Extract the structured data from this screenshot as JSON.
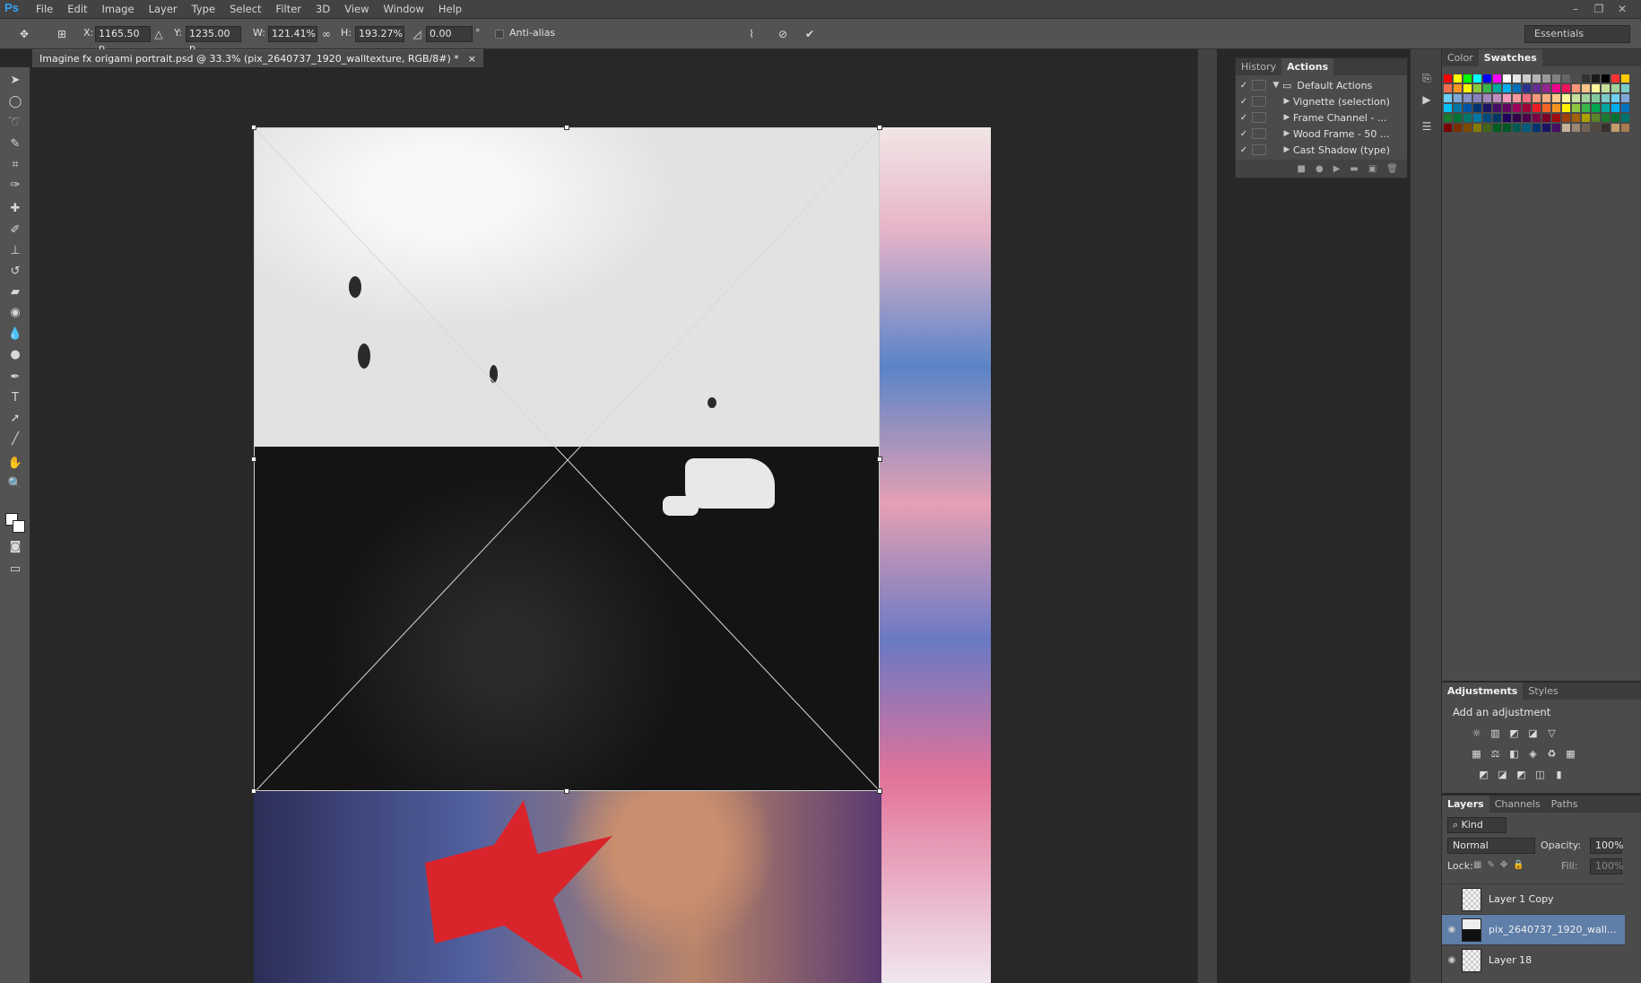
{
  "app": {
    "logo": "Ps"
  },
  "menu": [
    "File",
    "Edit",
    "Image",
    "Layer",
    "Type",
    "Select",
    "Filter",
    "3D",
    "View",
    "Window",
    "Help"
  ],
  "window_controls": [
    "–",
    "❐",
    "✕"
  ],
  "options": {
    "x_label": "X:",
    "x_value": "1165.50 p",
    "y_label": "Y:",
    "y_value": "1235.00 p",
    "w_label": "W:",
    "w_value": "121.41%",
    "h_label": "H:",
    "h_value": "193.27%",
    "angle_value": "0.00",
    "degree": "°",
    "antialias_label": "Anti-alias",
    "workspace": "Essentials"
  },
  "document": {
    "tab_title": "Imagine fx origami portrait.psd @ 33.3% (pix_2640737_1920_walltexture, RGB/8#) *",
    "close": "×"
  },
  "actions_panel": {
    "tabs": [
      "History",
      "Actions"
    ],
    "items": [
      {
        "label": "Default Actions",
        "check": "✓"
      },
      {
        "label": "Vignette (selection)",
        "check": "✓"
      },
      {
        "label": "Frame Channel - ...",
        "check": "✓"
      },
      {
        "label": "Wood Frame - 50 ...",
        "check": "✓"
      },
      {
        "label": "Cast Shadow (type)",
        "check": "✓"
      }
    ]
  },
  "swatches_panel": {
    "tabs": [
      "Color",
      "Swatches"
    ]
  },
  "colors": {
    "swatches": [
      "#ff0000",
      "#ffff00",
      "#00ff00",
      "#00ffff",
      "#0000ff",
      "#ff00ff",
      "#ffffff",
      "#e6e6e6",
      "#cccccc",
      "#b3b3b3",
      "#999999",
      "#808080",
      "#666666",
      "#4d4d4d",
      "#333333",
      "#1a1a1a",
      "#000000",
      "#ff3333",
      "#ffcc00",
      "#f26c4f",
      "#f7941d",
      "#fff200",
      "#8dc63f",
      "#39b54a",
      "#00a99d",
      "#00aeef",
      "#0072bc",
      "#2e3192",
      "#662d91",
      "#92278f",
      "#ec008c",
      "#ed145b",
      "#f69679",
      "#fdc689",
      "#fff799",
      "#c4df9b",
      "#a3d39c",
      "#7accc8",
      "#6dcff6",
      "#7da7d9",
      "#8393ca",
      "#8781bd",
      "#a187be",
      "#bd8cbf",
      "#f49ac1",
      "#f5989d",
      "#f26d7d",
      "#f7977a",
      "#fbad82",
      "#fdc68a",
      "#fff79a",
      "#c4df9b",
      "#a2d39c",
      "#82ca9c",
      "#7accc8",
      "#6ecff6",
      "#7ea7d8",
      "#00bff3",
      "#0076a3",
      "#0054a6",
      "#003471",
      "#1b1464",
      "#440e62",
      "#630460",
      "#9e005d",
      "#9e0039",
      "#ed1c24",
      "#f26522",
      "#f7941d",
      "#fff200",
      "#8dc73f",
      "#39b54a",
      "#00a651",
      "#00a99d",
      "#00aeef",
      "#0072bc",
      "#197b30",
      "#007236",
      "#00746b",
      "#0076a3",
      "#004a80",
      "#003663",
      "#21005d",
      "#32004b",
      "#4b0049",
      "#7b0046",
      "#7a0026",
      "#9e0b0f",
      "#a0410d",
      "#a36209",
      "#aba000",
      "#598527",
      "#1a7b30",
      "#007236",
      "#00746b",
      "#790000",
      "#7b2e00",
      "#7d4900",
      "#827b00",
      "#406618",
      "#005e20",
      "#005826",
      "#005952",
      "#005b7f",
      "#003471",
      "#1b1464",
      "#440e62",
      "#c7b299",
      "#998675",
      "#736357",
      "#534741",
      "#37302d",
      "#c69c6d",
      "#a67c52"
    ]
  },
  "adjustments_panel": {
    "tabs": [
      "Adjustments",
      "Styles"
    ],
    "title": "Add an adjustment",
    "icons_row1": [
      "☼",
      "▥",
      "◩",
      "◪",
      "▽"
    ],
    "icons_row2": [
      "▦",
      "⚖",
      "◧",
      "◈",
      "♻",
      "▦"
    ],
    "icons_row3": [
      "◩",
      "◪",
      "◩",
      "◫",
      "▮"
    ]
  },
  "layers_panel": {
    "tabs": [
      "Layers",
      "Channels",
      "Paths"
    ],
    "kind": "⌕ Kind",
    "blend_mode": "Normal",
    "opacity_label": "Opacity:",
    "opacity_value": "100%",
    "lock_label": "Lock:",
    "fill_label": "Fill:",
    "fill_value": "100%",
    "layers": [
      {
        "name": "Layer 1 Copy",
        "eye": ""
      },
      {
        "name": "pix_2640737_1920_wall...",
        "eye": "◉"
      },
      {
        "name": "Layer 18",
        "eye": "◉"
      }
    ]
  }
}
